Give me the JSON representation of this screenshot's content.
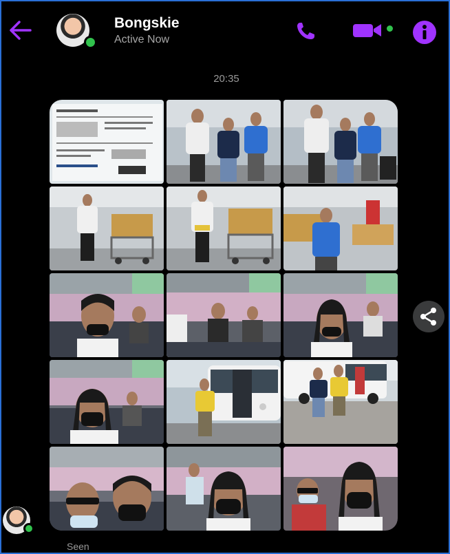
{
  "header": {
    "contact_name": "Bongskie",
    "status": "Active Now",
    "accent_color": "#a033ff",
    "online_color": "#31c24d",
    "icons": [
      "back-arrow-icon",
      "phone-icon",
      "video-camera-icon",
      "info-icon"
    ]
  },
  "conversation": {
    "timestamp": "20:35",
    "photos": [
      {
        "label": "boarding-pass-document"
      },
      {
        "label": "three-men-airport"
      },
      {
        "label": "three-men-airport-2"
      },
      {
        "label": "man-with-luggage-cart"
      },
      {
        "label": "man-with-luggage-cart-2"
      },
      {
        "label": "man-blue-shirt-carts"
      },
      {
        "label": "bus-selfie-1"
      },
      {
        "label": "bus-interior"
      },
      {
        "label": "bus-selfie-2"
      },
      {
        "label": "bus-selfie-3"
      },
      {
        "label": "man-beside-bus"
      },
      {
        "label": "two-men-beside-bus"
      },
      {
        "label": "two-men-selfie-bus"
      },
      {
        "label": "selfie-long-hair-bus"
      },
      {
        "label": "selfie-window-bus"
      }
    ],
    "seen_label": "Seen"
  },
  "share_icon": "share-icon"
}
